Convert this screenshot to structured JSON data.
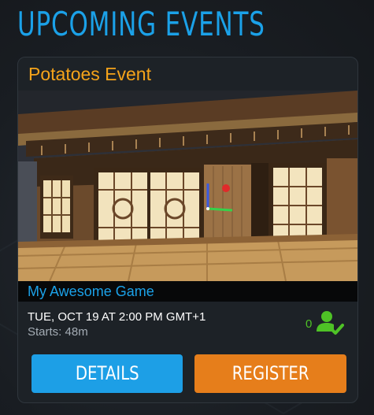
{
  "heading": "UPCOMING EVENTS",
  "event": {
    "title": "Potatoes Event",
    "game_name": "My Awesome Game",
    "datetime": "TUE, OCT 19 AT 2:00 PM GMT+1",
    "starts": "Starts: 48m",
    "registered_count": "0",
    "thumbnail_icon": "game-scene-screenshot"
  },
  "buttons": {
    "details_label": "DETAILS",
    "register_label": "REGISTER"
  },
  "icons": {
    "registered": "user-check-icon"
  },
  "colors": {
    "accent_blue": "#1ba1e8",
    "accent_orange": "#f5a31a",
    "details_button": "#1d9fe6",
    "register_button": "#e67e1b",
    "registered_green": "#4ec226",
    "card_background": "#1d2227",
    "page_background": "#181c21"
  }
}
